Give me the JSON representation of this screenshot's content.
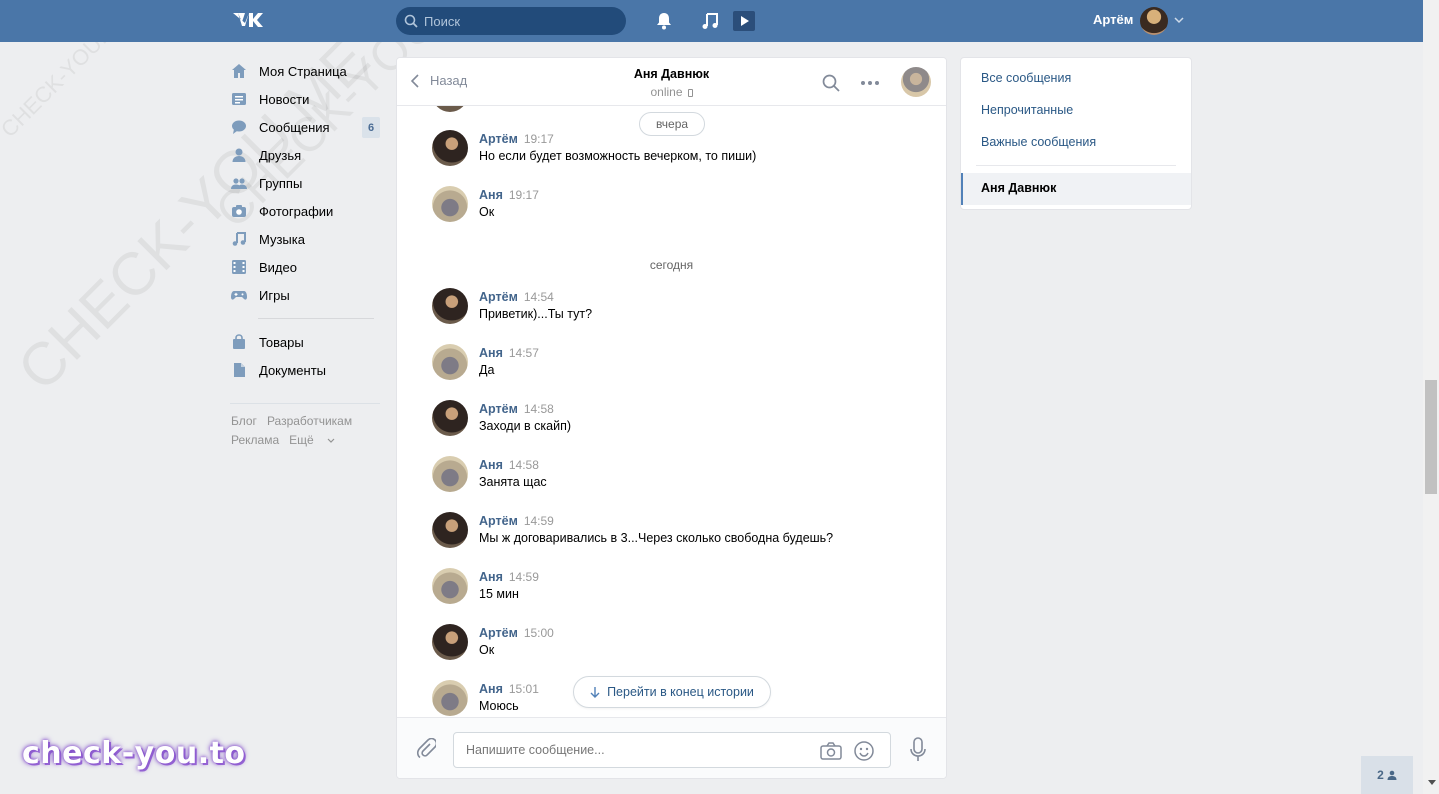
{
  "header": {
    "search_placeholder": "Поиск",
    "user_name": "Артём"
  },
  "leftnav": {
    "items": [
      {
        "label": "Моя Страница",
        "icon": "home-icon"
      },
      {
        "label": "Новости",
        "icon": "news-icon"
      },
      {
        "label": "Сообщения",
        "icon": "messages-icon",
        "badge": "6"
      },
      {
        "label": "Друзья",
        "icon": "friend-icon"
      },
      {
        "label": "Группы",
        "icon": "groups-icon"
      },
      {
        "label": "Фотографии",
        "icon": "camera-icon"
      },
      {
        "label": "Музыка",
        "icon": "music-icon"
      },
      {
        "label": "Видео",
        "icon": "video-icon"
      },
      {
        "label": "Игры",
        "icon": "gamepad-icon"
      }
    ],
    "items2": [
      {
        "label": "Товары",
        "icon": "bag-icon"
      },
      {
        "label": "Документы",
        "icon": "document-icon"
      }
    ],
    "footer": {
      "blog": "Блог",
      "developers": "Разработчикам",
      "ads": "Реклама",
      "more": "Ещё"
    }
  },
  "chat": {
    "back_label": "Назад",
    "peer_name": "Аня Давнюк",
    "peer_status": "online",
    "date_yesterday": "вчера",
    "date_today": "сегодня",
    "messages": [
      {
        "author": "Артём",
        "time": "19:17",
        "text": "Но если будет возможность вечерком, то пиши)"
      },
      {
        "author": "Аня",
        "time": "19:17",
        "text": "Ок"
      },
      {
        "author": "Артём",
        "time": "14:54",
        "text": "Приветик)...Ты тут?"
      },
      {
        "author": "Аня",
        "time": "14:57",
        "text": "Да"
      },
      {
        "author": "Артём",
        "time": "14:58",
        "text": "Заходи в скайп)"
      },
      {
        "author": "Аня",
        "time": "14:58",
        "text": "Занята щас"
      },
      {
        "author": "Артём",
        "time": "14:59",
        "text": "Мы ж договаривались в 3...Через сколько свободна будешь?"
      },
      {
        "author": "Аня",
        "time": "14:59",
        "text": "15 мин"
      },
      {
        "author": "Артём",
        "time": "15:00",
        "text": "Ок"
      },
      {
        "author": "Аня",
        "time": "15:01",
        "text": "Моюсь"
      }
    ],
    "jump_label": "Перейти в конец истории",
    "input_placeholder": "Напишите сообщение..."
  },
  "filters": {
    "all": "Все сообщения",
    "unread": "Непрочитанные",
    "important": "Важные сообщения",
    "active_chat": "Аня Давнюк"
  },
  "online_count": "2",
  "brand": "check-you.to",
  "watermark": "CHECK-YOU.ME",
  "colors": {
    "header": "#4a76a8",
    "link": "#2a5885",
    "author": "#42648b"
  }
}
